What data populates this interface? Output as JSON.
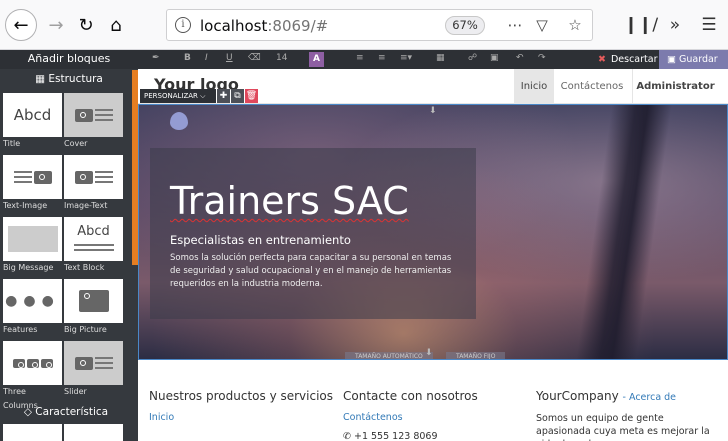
{
  "browser": {
    "url_host": "localhost",
    "url_rest": ":8069/#",
    "zoom": "67%",
    "icons": [
      "back-arrow-icon",
      "forward-arrow-icon",
      "reload-icon",
      "home-icon",
      "info-icon",
      "more-icon",
      "pocket-icon",
      "bookmark-star-icon",
      "library-icon",
      "overflow-icon"
    ]
  },
  "left_panel": {
    "title": "Añadir bloques",
    "section_structure": "Estructura",
    "section_feature": "Característica",
    "snippets": [
      {
        "label": "Title",
        "thumb_text": "Abcd"
      },
      {
        "label": "Cover",
        "thumb_text": ""
      },
      {
        "label": "Text-Image",
        "thumb_text": ""
      },
      {
        "label": "Image-Text",
        "thumb_text": ""
      },
      {
        "label": "Big Message",
        "thumb_text": ""
      },
      {
        "label": "Text Block",
        "thumb_text": "Abcd"
      },
      {
        "label": "Features",
        "thumb_text": ""
      },
      {
        "label": "Big Picture",
        "thumb_text": ""
      },
      {
        "label": "Three Columns",
        "thumb_text": ""
      },
      {
        "label": "Slider",
        "thumb_text": ""
      }
    ],
    "accent_color": "#e67e22"
  },
  "editor_toolbar": {
    "font_size": "14",
    "color_letter": "A",
    "discard_label": "Descartar",
    "save_label": "Guardar",
    "save_color": "#7c7bad"
  },
  "site_nav": {
    "logo": "Your logo",
    "links": [
      {
        "label": "Inicio",
        "active": true
      },
      {
        "label": "Contáctenos",
        "active": false
      }
    ],
    "user": "Administrator"
  },
  "customize": {
    "label": "PERSONALIZAR"
  },
  "hero": {
    "title": "Trainers SAC",
    "subtitle": "Especialistas en entrenamiento",
    "description": "Somos la solución perfecta para capacitar a su personal en temas de seguridad y salud ocupacional y en el manejo de herramientas requeridos en la industria moderna.",
    "bottom_left": "TAMAÑO AUTOMÁTICO",
    "bottom_right": "TAMAÑO FIJO"
  },
  "footer": {
    "col1_title": "Nuestros productos y servicios",
    "col1_link": "Inicio",
    "col2_title": "Contacte con nosotros",
    "col2_link": "Contáctenos",
    "col2_phone": "+1 555 123 8069",
    "col3_title": "YourCompany",
    "col3_about": "- Acerca de",
    "col3_text": "Somos un equipo de gente apasionada cuya meta es mejorar la vida de cada"
  }
}
